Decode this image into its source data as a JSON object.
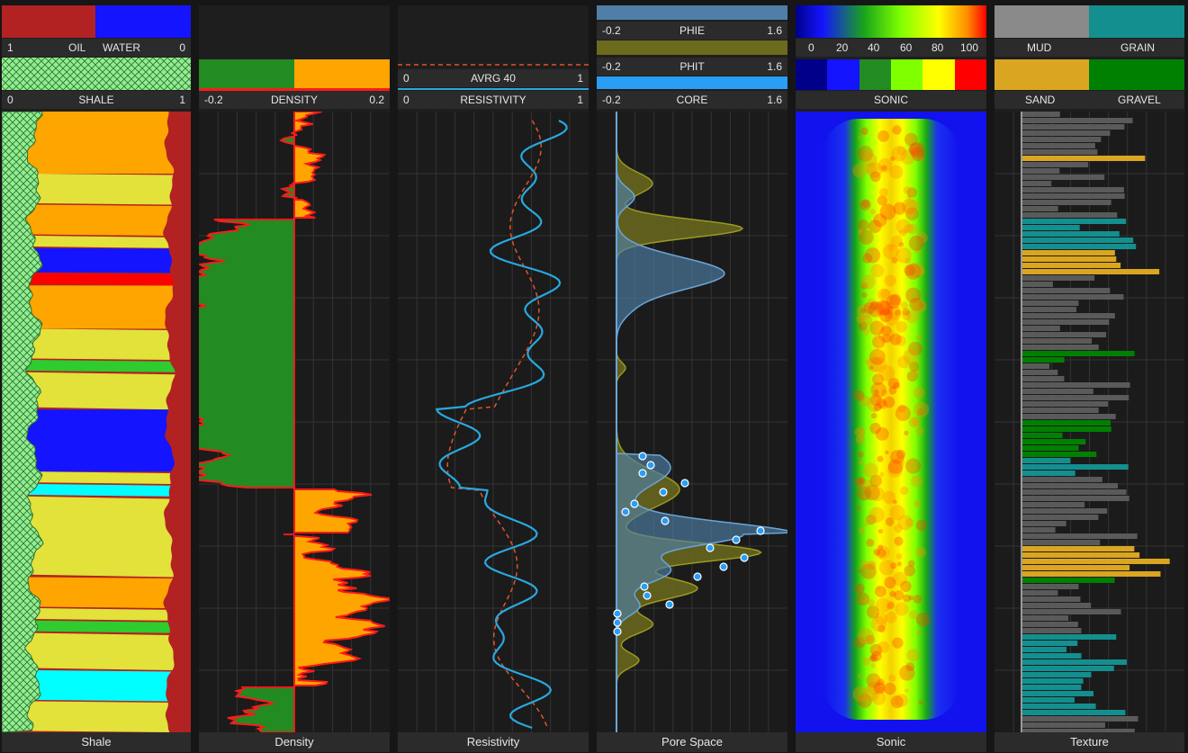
{
  "colors": {
    "oil": "#b22222",
    "water": "#1414ff",
    "shale": "#90ee90",
    "density_green": "#228b22",
    "density_orange": "#ffa500",
    "density_edge": "#ff1a1a",
    "resistivity": "#29a8e0",
    "avrg": "#e0552a",
    "phie": "#4f7fa8",
    "phit": "#6b6a1d",
    "core": "#2a9df4",
    "mud": "#8a8a8a",
    "grain": "#138f8f",
    "sand": "#daa520",
    "gravel": "#008000"
  },
  "tracks": [
    {
      "id": "shale",
      "footer": "Shale",
      "header_rows": [
        {
          "left": "1",
          "center": "OIL",
          "center2": "WATER",
          "right": "0"
        },
        {
          "left": "0",
          "center": "SHALE",
          "right": "1"
        }
      ]
    },
    {
      "id": "density",
      "footer": "Density",
      "header_rows": [
        {
          "left": "-0.2",
          "center": "DENSITY",
          "right": "0.2"
        }
      ]
    },
    {
      "id": "resistivity",
      "footer": "Resistivity",
      "header_rows": [
        {
          "left": "0",
          "center": "AVRG 40",
          "right": "1"
        },
        {
          "left": "0",
          "center": "RESISTIVITY",
          "right": "1"
        }
      ]
    },
    {
      "id": "porespace",
      "footer": "Pore Space",
      "header_rows": [
        {
          "left": "-0.2",
          "center": "PHIE",
          "right": "1.6"
        },
        {
          "left": "-0.2",
          "center": "PHIT",
          "right": "1.6"
        },
        {
          "left": "-0.2",
          "center": "CORE",
          "right": "1.6"
        }
      ]
    },
    {
      "id": "sonic",
      "footer": "Sonic",
      "header_rows": [
        {
          "ticks": [
            "0",
            "20",
            "40",
            "60",
            "80",
            "100"
          ]
        },
        {
          "center": "SONIC"
        }
      ]
    },
    {
      "id": "texture",
      "footer": "Texture",
      "header_rows": [
        {
          "left": "MUD",
          "right": "GRAIN"
        },
        {
          "left": "SAND",
          "right": "GRAVEL"
        }
      ]
    }
  ],
  "sonic_legend_colors": [
    "#00008b",
    "#1414ff",
    "#228b22",
    "#7fff00",
    "#ffff00",
    "#ff0000"
  ],
  "chart_data": [
    {
      "type": "area",
      "title": "Shale",
      "series": [
        {
          "name": "OIL"
        },
        {
          "name": "WATER"
        },
        {
          "name": "SHALE"
        }
      ],
      "lithology_bands": [
        {
          "from": 0.0,
          "to": 0.1,
          "color": "#ffa500"
        },
        {
          "from": 0.1,
          "to": 0.15,
          "color": "#e2e23a"
        },
        {
          "from": 0.15,
          "to": 0.2,
          "color": "#ffa500"
        },
        {
          "from": 0.2,
          "to": 0.22,
          "color": "#e2e23a"
        },
        {
          "from": 0.22,
          "to": 0.26,
          "color": "#1414ff"
        },
        {
          "from": 0.26,
          "to": 0.28,
          "color": "#ff0000"
        },
        {
          "from": 0.28,
          "to": 0.35,
          "color": "#ffa500"
        },
        {
          "from": 0.35,
          "to": 0.4,
          "color": "#e2e23a"
        },
        {
          "from": 0.4,
          "to": 0.42,
          "color": "#2ecc2e"
        },
        {
          "from": 0.42,
          "to": 0.48,
          "color": "#e2e23a"
        },
        {
          "from": 0.48,
          "to": 0.58,
          "color": "#1414ff"
        },
        {
          "from": 0.58,
          "to": 0.6,
          "color": "#e2e23a"
        },
        {
          "from": 0.6,
          "to": 0.62,
          "color": "#00ffff"
        },
        {
          "from": 0.62,
          "to": 0.75,
          "color": "#e2e23a"
        },
        {
          "from": 0.75,
          "to": 0.8,
          "color": "#ffa500"
        },
        {
          "from": 0.8,
          "to": 0.82,
          "color": "#e2e23a"
        },
        {
          "from": 0.82,
          "to": 0.84,
          "color": "#2ecc2e"
        },
        {
          "from": 0.84,
          "to": 0.9,
          "color": "#e2e23a"
        },
        {
          "from": 0.9,
          "to": 0.95,
          "color": "#00ffff"
        },
        {
          "from": 0.95,
          "to": 1.0,
          "color": "#e2e23a"
        }
      ]
    },
    {
      "type": "area",
      "title": "Density",
      "xlim": [
        -0.2,
        0.2
      ]
    },
    {
      "type": "line",
      "title": "Resistivity",
      "xlim": [
        0,
        1
      ],
      "series": [
        {
          "name": "RESISTIVITY"
        },
        {
          "name": "AVRG 40"
        }
      ]
    },
    {
      "type": "area",
      "title": "Pore Space",
      "xlim": [
        -0.2,
        1.6
      ],
      "series": [
        {
          "name": "PHIE"
        },
        {
          "name": "PHIT"
        },
        {
          "name": "CORE"
        }
      ]
    },
    {
      "type": "heatmap",
      "title": "Sonic",
      "xlim": [
        0,
        100
      ]
    },
    {
      "type": "bar",
      "title": "Texture",
      "series": [
        {
          "name": "MUD"
        },
        {
          "name": "GRAIN"
        },
        {
          "name": "SAND"
        },
        {
          "name": "GRAVEL"
        }
      ]
    }
  ]
}
